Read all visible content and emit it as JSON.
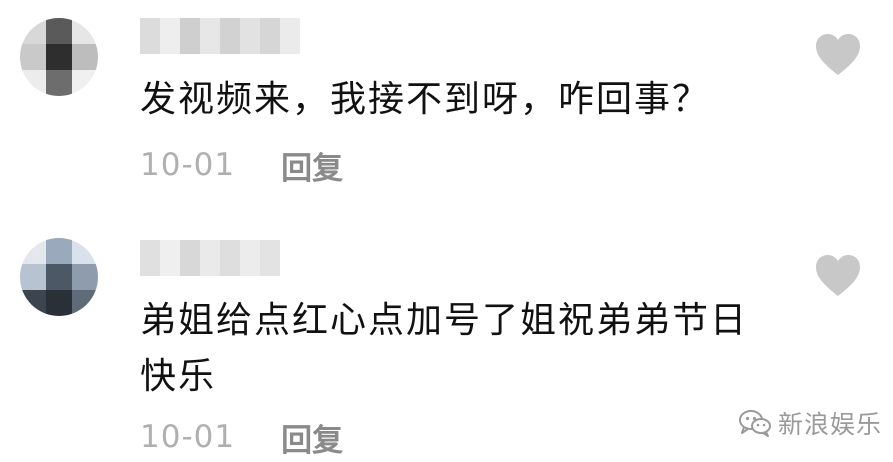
{
  "comments": [
    {
      "username": "",
      "text": "发视频来，我接不到呀，咋回事？",
      "date": "10-01",
      "reply_label": "回复"
    },
    {
      "username": "",
      "text": "弟姐给点红心点加号了姐祝弟弟节日快乐",
      "date": "10-01",
      "reply_label": "回复"
    }
  ],
  "icons": {
    "like": "heart-icon",
    "watermark_logo": "wechat-icon"
  },
  "watermark": {
    "text": "新浪娱乐"
  },
  "colors": {
    "text": "#111111",
    "meta": "#b0b0b0",
    "reply": "#8a8a8a",
    "heart": "#c8c8c8"
  }
}
